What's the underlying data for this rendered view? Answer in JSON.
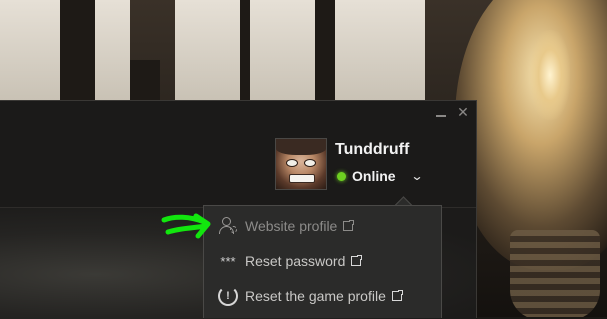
{
  "user": {
    "name": "Tunddruff",
    "status": "Online"
  },
  "dropdown": {
    "items": [
      {
        "label": "Website profile",
        "icon": "profile-gear-icon",
        "external": true,
        "enabled": false
      },
      {
        "label": "Reset password",
        "icon": "asterisks-icon",
        "external": true,
        "enabled": true
      },
      {
        "label": "Reset the game profile",
        "icon": "reset-icon",
        "external": true,
        "enabled": true
      }
    ]
  },
  "icons": {
    "minimize": "minimize-icon",
    "close": "close-icon",
    "status_chevron": "chevron-down-icon",
    "asterisks": "***",
    "reset_glyph": "!"
  },
  "colors": {
    "status_online": "#6ed021",
    "annotation_arrow": "#12e60e"
  }
}
